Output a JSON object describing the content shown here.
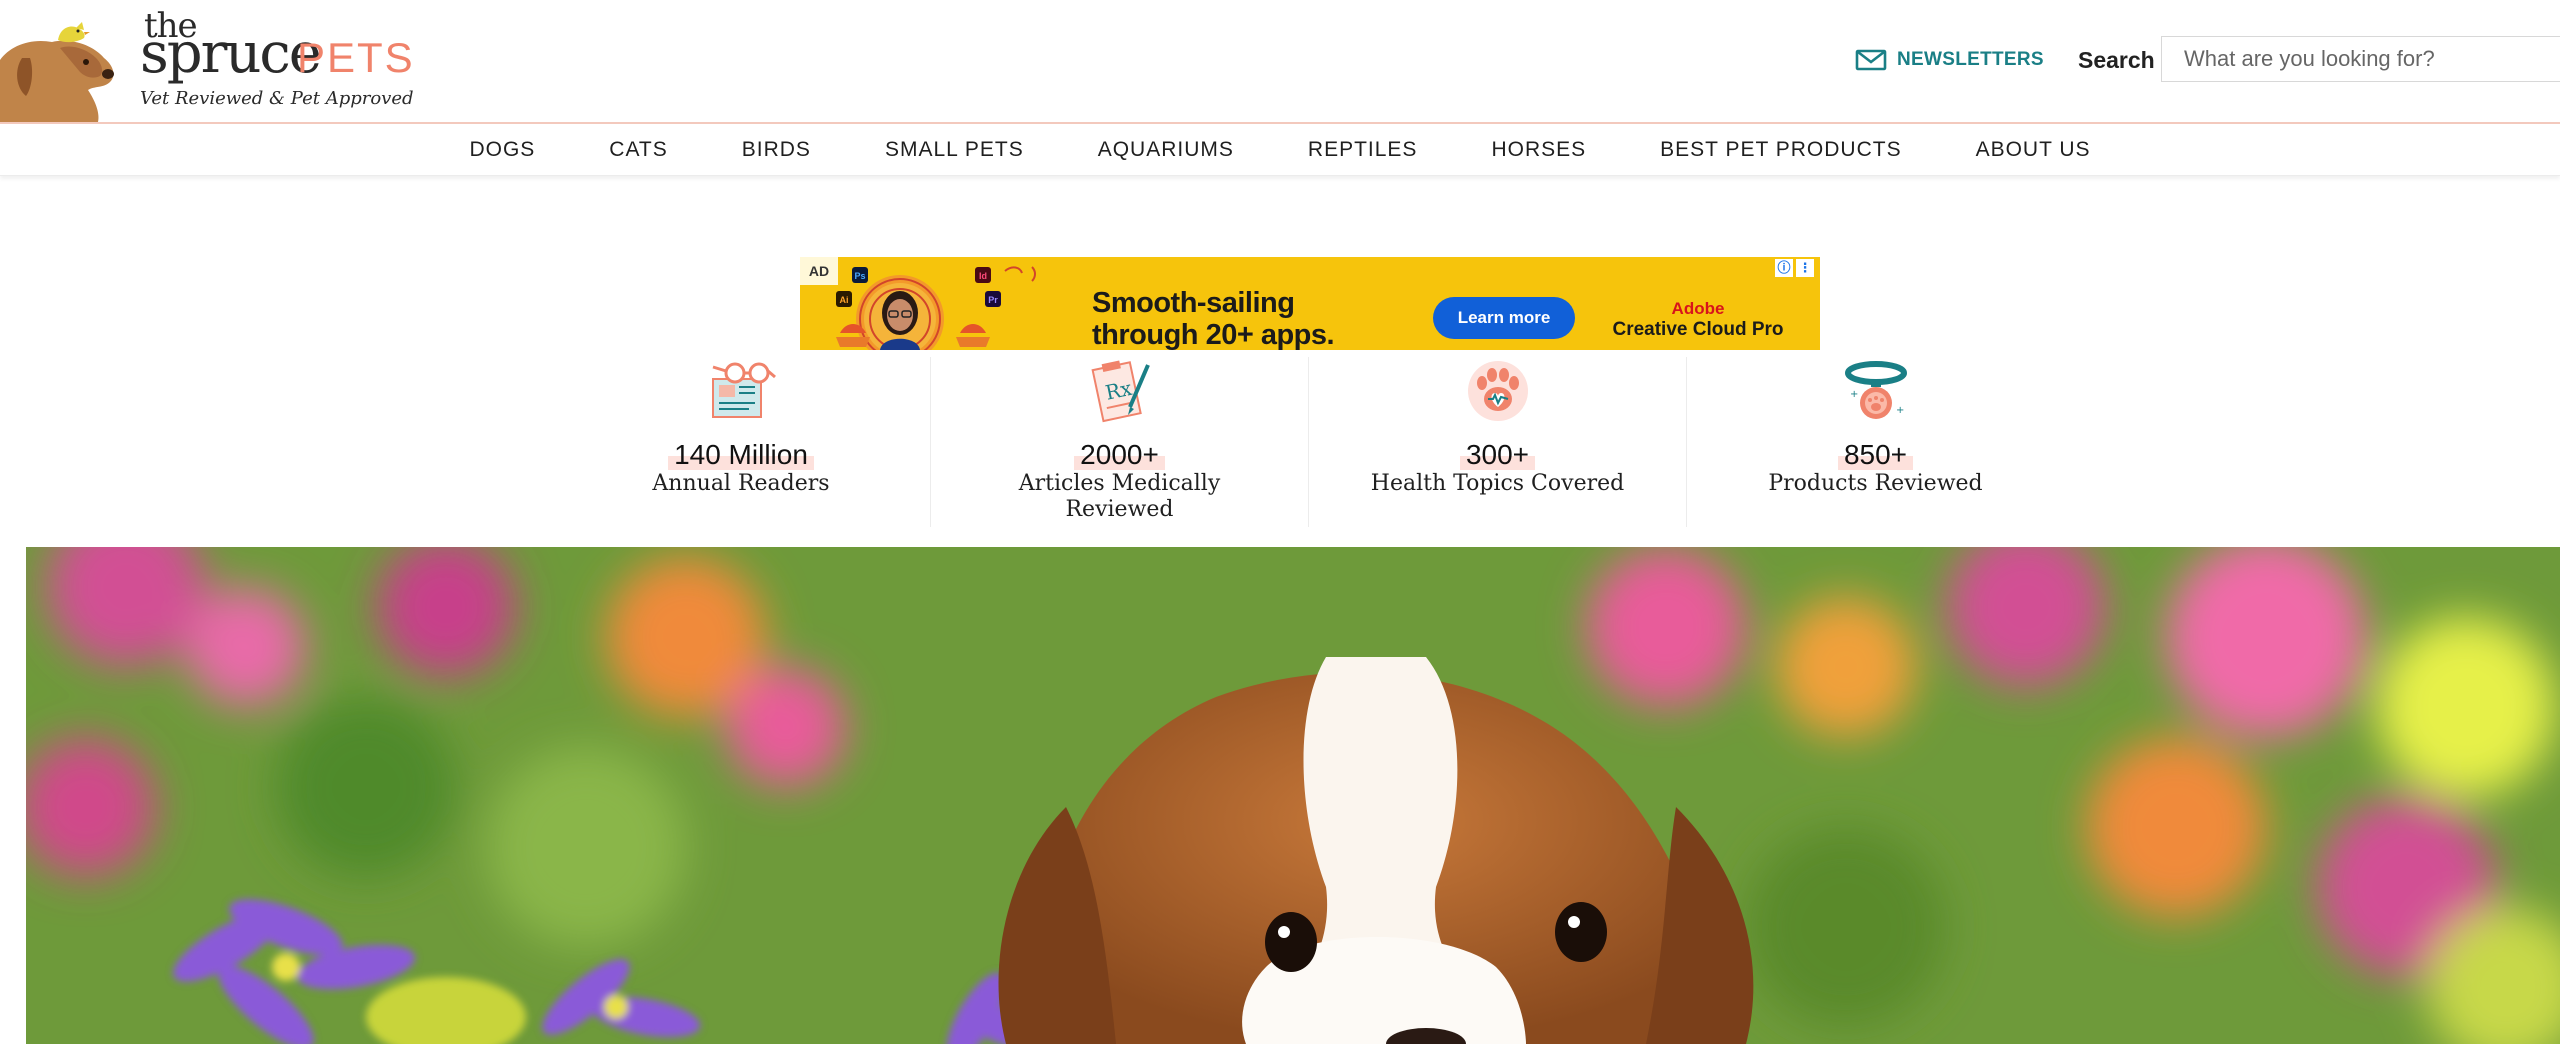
{
  "brand": {
    "logo_the": "the",
    "logo_spruce": "spruce",
    "logo_pets": "PETS",
    "tagline": "Vet Reviewed & Pet Approved",
    "accent_color": "#f0836b",
    "teal_color": "#1a7f86"
  },
  "header": {
    "newsletter_icon": "mail-icon",
    "newsletter_label": "NEWSLETTERS",
    "search_label": "Search",
    "search_placeholder": "What are you looking for?"
  },
  "nav": {
    "items": [
      {
        "label": "DOGS"
      },
      {
        "label": "CATS"
      },
      {
        "label": "BIRDS"
      },
      {
        "label": "SMALL PETS"
      },
      {
        "label": "AQUARIUMS"
      },
      {
        "label": "REPTILES"
      },
      {
        "label": "HORSES"
      },
      {
        "label": "BEST PET PRODUCTS"
      },
      {
        "label": "ABOUT US"
      }
    ]
  },
  "ad": {
    "badge": "AD",
    "headline_line1": "Smooth-sailing",
    "headline_line2": "through 20+ apps.",
    "cta": "Learn more",
    "brand_line1": "Adobe",
    "brand_line2": "Creative Cloud Pro",
    "app_icons": [
      "Ps",
      "Id",
      "Ai",
      "Pr"
    ],
    "info_icon": "info-icon",
    "menu_icon": "kebab-menu-icon",
    "background_color": "#f6c40c",
    "cta_color": "#1160d8"
  },
  "stats": [
    {
      "icon": "reading-glasses-icon",
      "value": "140 Million",
      "label": "Annual Readers"
    },
    {
      "icon": "prescription-clipboard-icon",
      "value": "2000+",
      "label": "Articles Medically Reviewed"
    },
    {
      "icon": "paw-heart-icon",
      "value": "300+",
      "label": "Health Topics Covered"
    },
    {
      "icon": "pet-collar-tag-icon",
      "value": "850+",
      "label": "Products Reviewed"
    }
  ],
  "hero": {
    "image": "puppy-in-flowers-photo"
  }
}
